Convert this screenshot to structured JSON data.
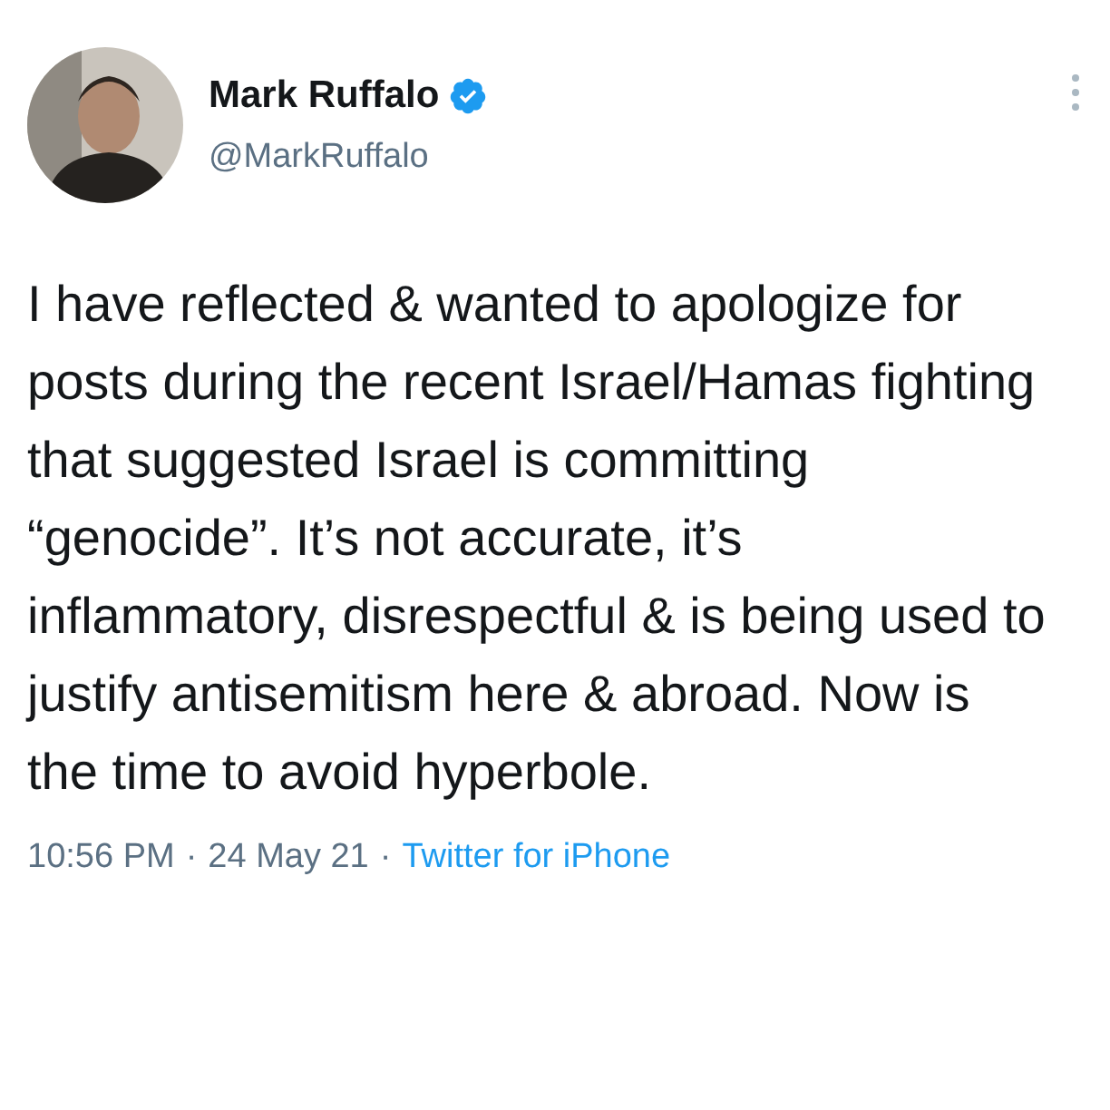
{
  "author": {
    "name": "Mark Ruffalo",
    "handle": "@MarkRuffalo",
    "verified": true
  },
  "tweet": {
    "text": "I have reflected & wanted to apologize for posts during the recent Israel/Hamas fighting that suggested Israel is committing “genocide”. It’s not accurate, it’s inflammatory, disrespectful & is being used to justify antisemitism here & abroad. Now is the time to avoid hyperbole."
  },
  "meta": [
    {
      "kind": "time",
      "text": "10:56 PM"
    },
    {
      "kind": "separator",
      "text": "·"
    },
    {
      "kind": "date",
      "text": "24 May 21"
    },
    {
      "kind": "separator",
      "text": "·"
    },
    {
      "kind": "source",
      "text": "Twitter for iPhone"
    }
  ]
}
